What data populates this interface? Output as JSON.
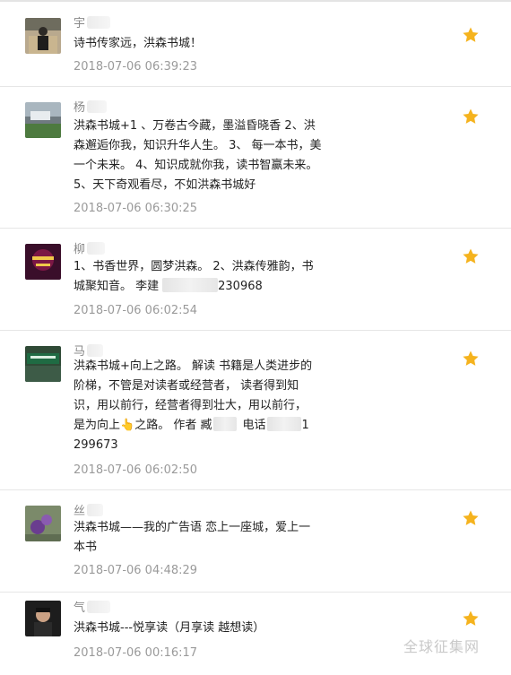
{
  "colors": {
    "star": "#f5b31e",
    "username": "#888888",
    "content": "#222222",
    "timestamp": "#9a9a9a",
    "divider": "#e6e6e6"
  },
  "comments": [
    {
      "username": "宇",
      "lines": [
        "诗书传家远，洪森书城！"
      ],
      "timestamp": "2018-07-06 06:39:23",
      "icon": "star-icon"
    },
    {
      "username": "杨",
      "lines": [
        "洪森书城+1 、万卷古今藏，墨溢昏晓香 2、洪",
        "森邂逅你我，知识升华人生。 3、 每一本书，美",
        "一个未来。 4、知识成就你我，读书智赢未来。",
        "5、天下奇观看尽，不如洪森书城好"
      ],
      "timestamp": "2018-07-06 06:30:25",
      "icon": "star-icon"
    },
    {
      "username": "柳",
      "lines": [
        "1、书香世界，圆梦洪森。 2、洪森传雅韵，书",
        "城聚知音。 李建"
      ],
      "line2_tail": "230968",
      "timestamp": "2018-07-06 06:02:54",
      "icon": "star-icon"
    },
    {
      "username": "马",
      "lines": [
        "洪森书城+向上之路。 解读 书籍是人类进步的",
        "阶梯，不管是对读者或经营者， 读者得到知",
        "识，用以前行，经营者得到壮大，用以前行，"
      ],
      "line4_head": "是为向上",
      "line4_mid": "之路。 作者 臧",
      "line4_phone": "电话",
      "line4_tail": "1",
      "line5": "299673",
      "timestamp": "2018-07-06 06:02:50",
      "icon": "star-icon"
    },
    {
      "username": "丝",
      "lines": [
        "洪森书城——我的广告语 恋上一座城，爱上一",
        "本书"
      ],
      "timestamp": "2018-07-06 04:48:29",
      "icon": "star-icon"
    },
    {
      "username": "气",
      "lines": [
        "洪森书城---悦享读（月享读 越想读）"
      ],
      "timestamp": "2018-07-06 00:16:17",
      "icon": "star-icon"
    }
  ],
  "watermark": "全球征集网"
}
